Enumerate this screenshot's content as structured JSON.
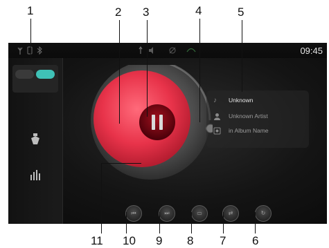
{
  "callouts": [
    "1",
    "2",
    "3",
    "4",
    "5",
    "6",
    "7",
    "8",
    "9",
    "10",
    "11"
  ],
  "status_bar": {
    "time": "09:45",
    "icons": [
      "antenna-icon",
      "phone-icon",
      "bluetooth-icon",
      "usb-icon",
      "sound-icon",
      "mute-icon",
      "link-icon"
    ]
  },
  "sidebar": {
    "source_toggle": {
      "left": "",
      "right": "",
      "label": ""
    },
    "items": [
      {
        "label": "",
        "icon": "text-only"
      },
      {
        "label": "",
        "icon": "radio-icon"
      },
      {
        "label": "",
        "icon": "audio-equalizer-icon"
      }
    ]
  },
  "player": {
    "play_state_icon": "pause-icon",
    "accent_color": "#e8334a"
  },
  "track_info": {
    "title": "Unknown",
    "artist": "Unknown Artist",
    "album": "in Album Name",
    "title_icon": "music-note-icon",
    "artist_icon": "person-icon",
    "album_icon": "album-icon"
  },
  "controls": [
    {
      "name": "previous-button",
      "icon": "prev-icon"
    },
    {
      "name": "next-button",
      "icon": "next-icon"
    },
    {
      "name": "browse-button",
      "icon": "browse-icon"
    },
    {
      "name": "shuffle-button",
      "icon": "shuffle-icon"
    },
    {
      "name": "repeat-button",
      "icon": "repeat-icon"
    }
  ],
  "time_label": {
    "elapsed": ""
  }
}
